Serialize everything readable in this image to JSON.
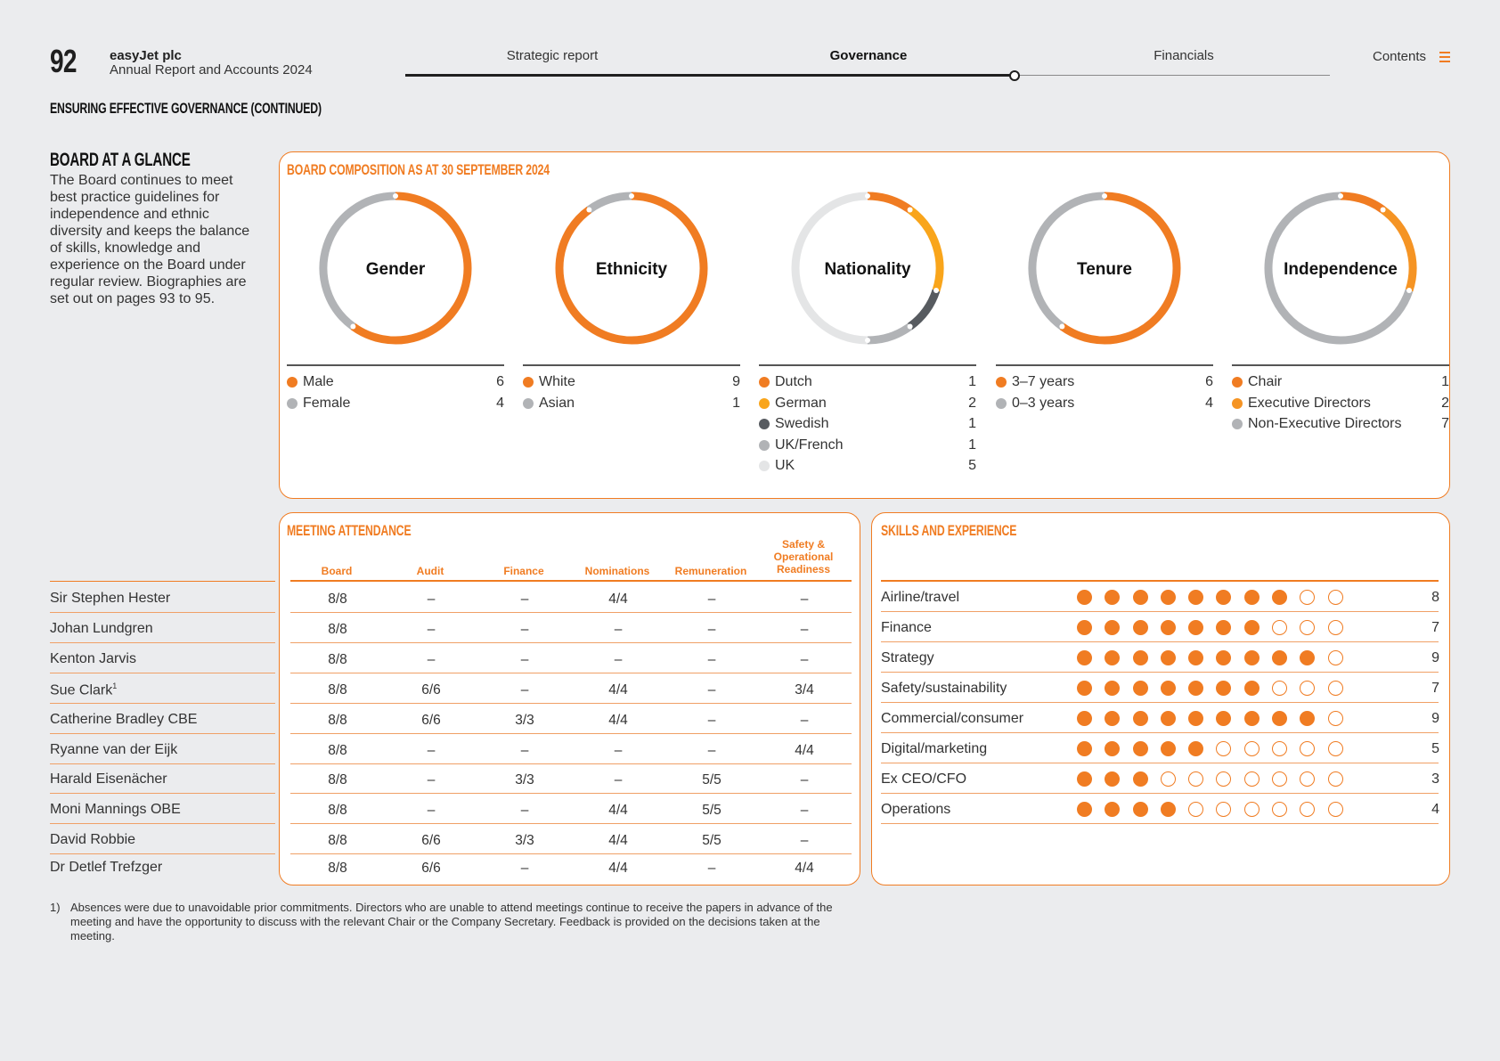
{
  "header": {
    "page_number": "92",
    "company": "easyJet plc",
    "report": "Annual Report and Accounts 2024",
    "nav": [
      {
        "label": "Strategic report",
        "active": false
      },
      {
        "label": "Governance",
        "active": true
      },
      {
        "label": "Financials",
        "active": false
      }
    ],
    "contents_label": "Contents"
  },
  "section_heading": "ENSURING EFFECTIVE GOVERNANCE (CONTINUED)",
  "glance": {
    "title": "BOARD AT A GLANCE",
    "text": "The Board continues to meet best practice guidelines for independence and ethnic diversity and keeps the balance of skills, knowledge and experience on the Board under regular review. Biographies are set out on pages 93 to 95."
  },
  "composition": {
    "title": "BOARD COMPOSITION AS AT 30 SEPTEMBER 2024",
    "charts": [
      {
        "name": "Gender",
        "items": [
          {
            "label": "Male",
            "value": 6,
            "color": "#f07c22"
          },
          {
            "label": "Female",
            "value": 4,
            "color": "#b1b3b6"
          }
        ]
      },
      {
        "name": "Ethnicity",
        "items": [
          {
            "label": "White",
            "value": 9,
            "color": "#f07c22"
          },
          {
            "label": "Asian",
            "value": 1,
            "color": "#b1b3b6"
          }
        ]
      },
      {
        "name": "Nationality",
        "items": [
          {
            "label": "Dutch",
            "value": 1,
            "color": "#f07c22"
          },
          {
            "label": "German",
            "value": 2,
            "color": "#f9a51b"
          },
          {
            "label": "Swedish",
            "value": 1,
            "color": "#575b60"
          },
          {
            "label": "UK/French",
            "value": 1,
            "color": "#b1b3b6"
          },
          {
            "label": "UK",
            "value": 5,
            "color": "#e4e5e6"
          }
        ]
      },
      {
        "name": "Tenure",
        "items": [
          {
            "label": "3–7 years",
            "value": 6,
            "color": "#f07c22"
          },
          {
            "label": "0–3 years",
            "value": 4,
            "color": "#b1b3b6"
          }
        ]
      },
      {
        "name": "Independence",
        "items": [
          {
            "label": "Chair",
            "value": 1,
            "color": "#f07c22"
          },
          {
            "label": "Executive Directors",
            "value": 2,
            "color": "#f59424"
          },
          {
            "label": "Non-Executive Directors",
            "value": 7,
            "color": "#b1b3b6"
          }
        ]
      }
    ]
  },
  "attendance": {
    "title": "MEETING ATTENDANCE",
    "columns": [
      "Board",
      "Audit",
      "Finance",
      "Nominations",
      "Remuneration",
      "Safety & Operational Readiness"
    ],
    "rows": [
      {
        "name": "Sir Stephen Hester",
        "sup": "",
        "values": [
          "8/8",
          "–",
          "–",
          "4/4",
          "–",
          "–"
        ]
      },
      {
        "name": "Johan Lundgren",
        "sup": "",
        "values": [
          "8/8",
          "–",
          "–",
          "–",
          "–",
          "–"
        ]
      },
      {
        "name": "Kenton Jarvis",
        "sup": "",
        "values": [
          "8/8",
          "–",
          "–",
          "–",
          "–",
          "–"
        ]
      },
      {
        "name": "Sue Clark",
        "sup": "1",
        "values": [
          "8/8",
          "6/6",
          "–",
          "4/4",
          "–",
          "3/4"
        ]
      },
      {
        "name": "Catherine Bradley CBE",
        "sup": "",
        "values": [
          "8/8",
          "6/6",
          "3/3",
          "4/4",
          "–",
          "–"
        ]
      },
      {
        "name": "Ryanne van der Eijk",
        "sup": "",
        "values": [
          "8/8",
          "–",
          "–",
          "–",
          "–",
          "4/4"
        ]
      },
      {
        "name": "Harald Eisenächer",
        "sup": "",
        "values": [
          "8/8",
          "–",
          "3/3",
          "–",
          "5/5",
          "–"
        ]
      },
      {
        "name": "Moni Mannings OBE",
        "sup": "",
        "values": [
          "8/8",
          "–",
          "–",
          "4/4",
          "5/5",
          "–"
        ]
      },
      {
        "name": "David Robbie",
        "sup": "",
        "values": [
          "8/8",
          "6/6",
          "3/3",
          "4/4",
          "5/5",
          "–"
        ]
      },
      {
        "name": "Dr Detlef Trefzger",
        "sup": "",
        "values": [
          "8/8",
          "6/6",
          "–",
          "4/4",
          "–",
          "4/4"
        ]
      }
    ]
  },
  "skills": {
    "title": "SKILLS AND EXPERIENCE",
    "max": 10,
    "rows": [
      {
        "label": "Airline/travel",
        "value": 8
      },
      {
        "label": "Finance",
        "value": 7
      },
      {
        "label": "Strategy",
        "value": 9
      },
      {
        "label": "Safety/sustainability",
        "value": 7
      },
      {
        "label": "Commercial/consumer",
        "value": 9
      },
      {
        "label": "Digital/marketing",
        "value": 5
      },
      {
        "label": "Ex CEO/CFO",
        "value": 3
      },
      {
        "label": "Operations",
        "value": 4
      }
    ]
  },
  "footnote": {
    "mark": "1)",
    "text": "Absences were due to unavoidable prior commitments. Directors who are unable to attend meetings continue to receive the papers in advance of the meeting and have the opportunity to discuss with the relevant Chair or the Company Secretary. Feedback is provided on the decisions taken at the meeting."
  }
}
